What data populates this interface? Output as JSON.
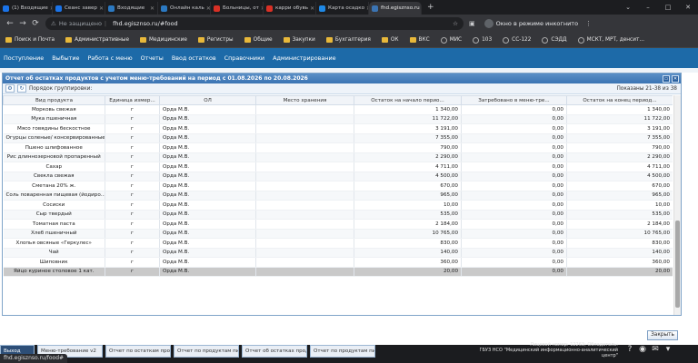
{
  "browser": {
    "tabs": [
      {
        "title": "(1) Входящие",
        "color": "#1a73e8"
      },
      {
        "title": "Сеанс завер",
        "color": "#1a73e8"
      },
      {
        "title": "Входящие",
        "color": "#2b79c2"
      },
      {
        "title": "Онлайн каль",
        "color": "#2b79c2"
      },
      {
        "title": "Больницы, от",
        "color": "#d93025"
      },
      {
        "title": "карри обувь",
        "color": "#d93025"
      },
      {
        "title": "Карта осадко",
        "color": "#1e88e5"
      },
      {
        "title": "fhd.egisznso.ru",
        "color": "#3b74b3"
      }
    ],
    "new_tab": "+",
    "not_secure": "Не защищено",
    "url": "fhd.egisznso.ru/#food",
    "incognito": "Окно в режиме инкогнито",
    "bookmarks": [
      {
        "label": "Поиск и Почта",
        "type": "folder"
      },
      {
        "label": "Административные",
        "type": "folder"
      },
      {
        "label": "Медицинские",
        "type": "folder"
      },
      {
        "label": "Регистры",
        "type": "folder"
      },
      {
        "label": "Общие",
        "type": "folder"
      },
      {
        "label": "Закупки",
        "type": "folder"
      },
      {
        "label": "Бухгалтерия",
        "type": "folder"
      },
      {
        "label": "ОК",
        "type": "folder"
      },
      {
        "label": "ВКС",
        "type": "folder"
      },
      {
        "label": "МИС",
        "type": "globe"
      },
      {
        "label": "103",
        "type": "globe"
      },
      {
        "label": "СС-122",
        "type": "globe"
      },
      {
        "label": "СЭДД",
        "type": "globe"
      },
      {
        "label": "МСКТ, МРТ, денсит...",
        "type": "globe"
      }
    ]
  },
  "menu": [
    "Поступление",
    "Выбытие",
    "Работа с меню",
    "Отчеты",
    "Ввод остатков",
    "Справочники",
    "Администрирование"
  ],
  "panel": {
    "title": "Отчет об остатках продуктов с учетом меню-требований на период с 01.08.2026 по 20.08.2026",
    "grouping_label": "Порядок группировки:",
    "shown": "Показаны 21-38 из 38",
    "close_button": "Закрыть"
  },
  "table": {
    "columns": [
      "Вид продукта",
      "Единица измер...",
      "ОЛ",
      "Место хранения",
      "Остаток на начало перио...",
      "Затребовано в меню-тре...",
      "Остаток на конец период..."
    ],
    "rows": [
      [
        "Морковь свежая",
        "г",
        "Орда М.В.",
        "",
        "1 340,00",
        "0,00",
        "1 340,00"
      ],
      [
        "Мука пшеничная",
        "г",
        "Орда М.В.",
        "",
        "11 722,00",
        "0,00",
        "11 722,00"
      ],
      [
        "Мясо говядины бескостное",
        "г",
        "Орда М.В.",
        "",
        "3 191,00",
        "0,00",
        "3 191,00"
      ],
      [
        "Огурцы соленые/ консервированные",
        "г",
        "Орда М.В.",
        "",
        "7 355,00",
        "0,00",
        "7 355,00"
      ],
      [
        "Пшено шлифованное",
        "г",
        "Орда М.В.",
        "",
        "790,00",
        "0,00",
        "790,00"
      ],
      [
        "Рис длиннозерновой пропаренный",
        "г",
        "Орда М.В.",
        "",
        "2 290,00",
        "0,00",
        "2 290,00"
      ],
      [
        "Сахар",
        "г",
        "Орда М.В.",
        "",
        "4 711,00",
        "0,00",
        "4 711,00"
      ],
      [
        "Свекла свежая",
        "г",
        "Орда М.В.",
        "",
        "4 500,00",
        "0,00",
        "4 500,00"
      ],
      [
        "Сметана 20% ж.",
        "г",
        "Орда М.В.",
        "",
        "670,00",
        "0,00",
        "670,00"
      ],
      [
        "Соль поваренная пищевая (йодиро...",
        "г",
        "Орда М.В.",
        "",
        "965,00",
        "0,00",
        "965,00"
      ],
      [
        "Сосиски",
        "г",
        "Орда М.В.",
        "",
        "10,00",
        "0,00",
        "10,00"
      ],
      [
        "Сыр твердый",
        "г",
        "Орда М.В.",
        "",
        "535,00",
        "0,00",
        "535,00"
      ],
      [
        "Томатная паста",
        "г",
        "Орда М.В.",
        "",
        "2 184,00",
        "0,00",
        "2 184,00"
      ],
      [
        "Хлеб пшеничный",
        "г",
        "Орда М.В.",
        "",
        "10 765,00",
        "0,00",
        "10 765,00"
      ],
      [
        "Хлопья овсяные «Геркулес»",
        "г",
        "Орда М.В.",
        "",
        "830,00",
        "0,00",
        "830,00"
      ],
      [
        "Чай",
        "г",
        "Орда М.В.",
        "",
        "140,00",
        "0,00",
        "140,00"
      ],
      [
        "Шиповник",
        "г",
        "Орда М.В.",
        "",
        "360,00",
        "0,00",
        "360,00"
      ],
      [
        "Яйцо куриное столовое 1 кат.",
        "г",
        "Орда М.В.",
        "",
        "20,00",
        "0,00",
        "20,00"
      ]
    ],
    "selected_row": 17
  },
  "window_tabs": [
    "Выход",
    "Меню-требование v2",
    "Отчет по остаткам продуктов",
    "Отчет по продуктам питания...",
    "Отчет об остатках продукто...",
    "Отчет по продуктам питания..."
  ],
  "footer": {
    "line1": "Лицевой номер: 12263; Обладатель:",
    "line2": "ГБУЗ НСО \"Медицинский информационно-аналитический центр\""
  },
  "status_url": "fhd.egisznso.ru/food#"
}
